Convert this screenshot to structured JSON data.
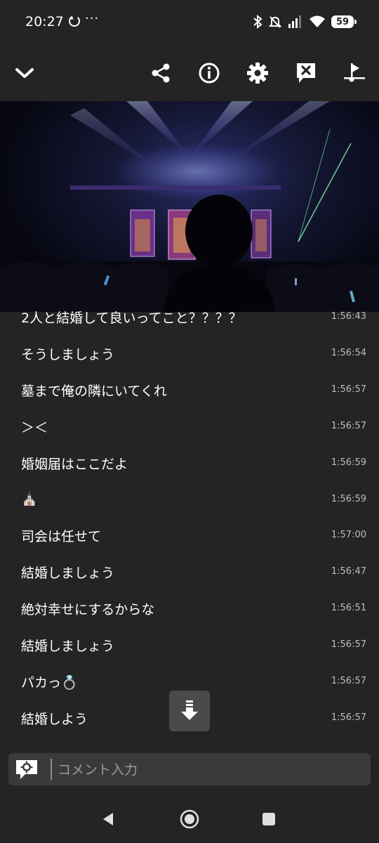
{
  "status_bar": {
    "time": "20:27",
    "more": "···",
    "battery": "59"
  },
  "toolbar": {
    "icons": [
      "chevron-down-icon",
      "share-icon",
      "info-icon",
      "settings-icon",
      "close-comments-icon",
      "playlist-icon"
    ]
  },
  "comments": [
    {
      "text": "2人と結婚して良いってこと？？？？",
      "time": "1:56:43"
    },
    {
      "text": "そうしましょう",
      "time": "1:56:54"
    },
    {
      "text": "墓まで俺の隣にいてくれ",
      "time": "1:56:57"
    },
    {
      "text": "＞＜",
      "time": "1:56:57"
    },
    {
      "text": "婚姻届はここだよ",
      "time": "1:56:59"
    },
    {
      "text": "⛪",
      "time": "1:56:59"
    },
    {
      "text": "司会は任せて",
      "time": "1:57:00"
    },
    {
      "text": "結婚しましょう",
      "time": "1:56:47"
    },
    {
      "text": "絶対幸せにするからな",
      "time": "1:56:51"
    },
    {
      "text": "結婚しましょう",
      "time": "1:56:57"
    },
    {
      "text": "パカっ💍",
      "time": "1:56:57"
    },
    {
      "text": "結婚しよう",
      "time": "1:56:57"
    }
  ],
  "comment_input": {
    "placeholder": "コメント入力"
  },
  "colors": {
    "background": "#242424",
    "input_bg": "#3a3a3a",
    "timestamp": "#bdbdbd"
  }
}
